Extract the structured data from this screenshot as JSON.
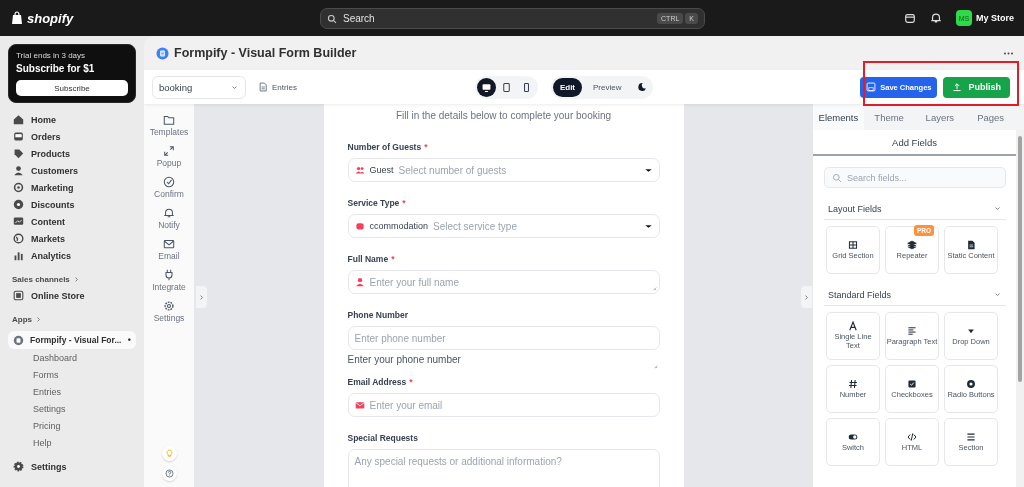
{
  "topbar": {
    "logo": "shopify",
    "search": {
      "placeholder": "Search",
      "shortcut": [
        "CTRL",
        "K"
      ]
    },
    "avatar": "MS",
    "store": "My Store"
  },
  "sidebar": {
    "trial": {
      "title": "Trial ends in 3 days",
      "subtitle": "Subscribe for $1",
      "button": "Subscribe"
    },
    "items": [
      {
        "label": "Home"
      },
      {
        "label": "Orders"
      },
      {
        "label": "Products"
      },
      {
        "label": "Customers"
      },
      {
        "label": "Marketing"
      },
      {
        "label": "Discounts"
      },
      {
        "label": "Content"
      },
      {
        "label": "Markets"
      },
      {
        "label": "Analytics"
      }
    ],
    "sales_channels": "Sales channels",
    "channels": [
      {
        "label": "Online Store"
      }
    ],
    "apps": "Apps",
    "app": {
      "label": "Formpify - Visual For...",
      "selected": true,
      "pin": "•",
      "children": [
        {
          "label": "Dashboard"
        },
        {
          "label": "Forms"
        },
        {
          "label": "Entries"
        },
        {
          "label": "Settings"
        },
        {
          "label": "Pricing"
        },
        {
          "label": "Help"
        }
      ]
    },
    "settings": "Settings"
  },
  "app_header": {
    "title": "Formpify - Visual Form Builder"
  },
  "toolbar": {
    "form_select": "booking",
    "entries": "Entries",
    "devices": [
      {
        "selected": true
      },
      {
        "selected": false
      },
      {
        "selected": false
      }
    ],
    "modes": [
      {
        "label": "Edit",
        "selected": true
      },
      {
        "label": "Preview",
        "selected": false
      }
    ],
    "save": "Save Changes",
    "publish": "Publish",
    "highlighted": true
  },
  "rail": [
    {
      "label": "Templates"
    },
    {
      "label": "Popup"
    },
    {
      "label": "Confirm"
    },
    {
      "label": "Notify"
    },
    {
      "label": "Email"
    },
    {
      "label": "Integrate"
    },
    {
      "label": "Settings"
    }
  ],
  "form": {
    "subtitle": "Fill in the details below to complete your booking",
    "fields": [
      {
        "kind": "select",
        "label": "Number of Guests",
        "required_mark": "*",
        "has_icon": true,
        "overlay_text": "Guest",
        "placeholder": "Select number of guests"
      },
      {
        "kind": "select",
        "label": "Service Type",
        "required_mark": "*",
        "has_icon": true,
        "overlay_text": "ccommodation",
        "placeholder": "Select service type"
      },
      {
        "kind": "text",
        "label": "Full Name",
        "required_mark": "*",
        "has_icon": true,
        "resizable": true,
        "placeholder": "Enter your full name"
      },
      {
        "kind": "phone",
        "label": "Phone Number",
        "placeholder": "Enter phone number",
        "helper": "Enter your phone number"
      },
      {
        "kind": "text",
        "label": "Email Address",
        "required_mark": "*",
        "has_icon": true,
        "resizable": false,
        "placeholder": "Enter your email"
      },
      {
        "kind": "textarea",
        "label": "Special Requests",
        "placeholder": "Any special requests or additional information?"
      }
    ]
  },
  "panel": {
    "tabs": [
      {
        "label": "Elements",
        "selected": true
      },
      {
        "label": "Theme",
        "selected": false
      },
      {
        "label": "Layers",
        "selected": false
      },
      {
        "label": "Pages",
        "selected": false
      }
    ],
    "subheader": "Add Fields",
    "search_placeholder": "Search fields...",
    "sections": [
      {
        "title": "Layout Fields",
        "expanded": true,
        "items": [
          {
            "label": "Grid Section"
          },
          {
            "label": "Repeater",
            "badge": "PRO"
          },
          {
            "label": "Static Content"
          }
        ]
      },
      {
        "title": "Standard Fields",
        "expanded": true,
        "items": [
          {
            "label": "Single Line Text"
          },
          {
            "label": "Paragraph Text"
          },
          {
            "label": "Drop Down"
          },
          {
            "label": "Number"
          },
          {
            "label": "Checkboxes"
          },
          {
            "label": "Radio Buttons"
          },
          {
            "label": "Switch"
          },
          {
            "label": "HTML"
          },
          {
            "label": "Section"
          }
        ]
      }
    ]
  }
}
